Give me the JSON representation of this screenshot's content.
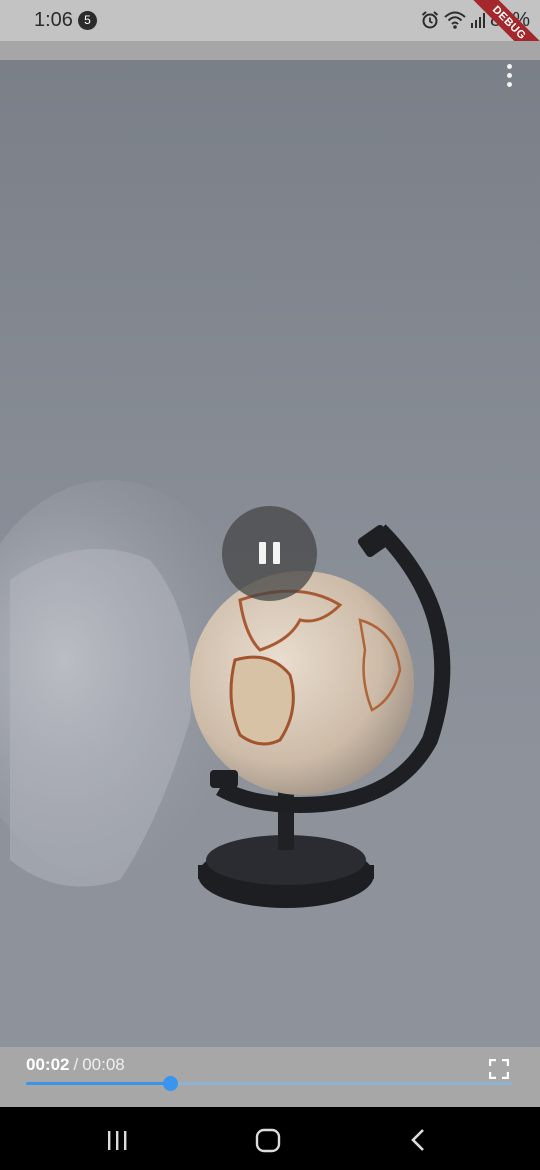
{
  "status_bar": {
    "time": "1:06",
    "notification_count": "5",
    "battery": "86%",
    "icons": [
      "alarm-icon",
      "wifi-icon",
      "signal-icon"
    ],
    "debug_banner": "DEBUG"
  },
  "player": {
    "current_time": "00:02",
    "separator": "/",
    "total_time": "00:08",
    "progress": 0.296,
    "state_icon": "pause-icon",
    "accent_color": "#3a95ef"
  },
  "nav_bar": {
    "buttons": [
      "recents-icon",
      "home-icon",
      "back-icon"
    ]
  }
}
